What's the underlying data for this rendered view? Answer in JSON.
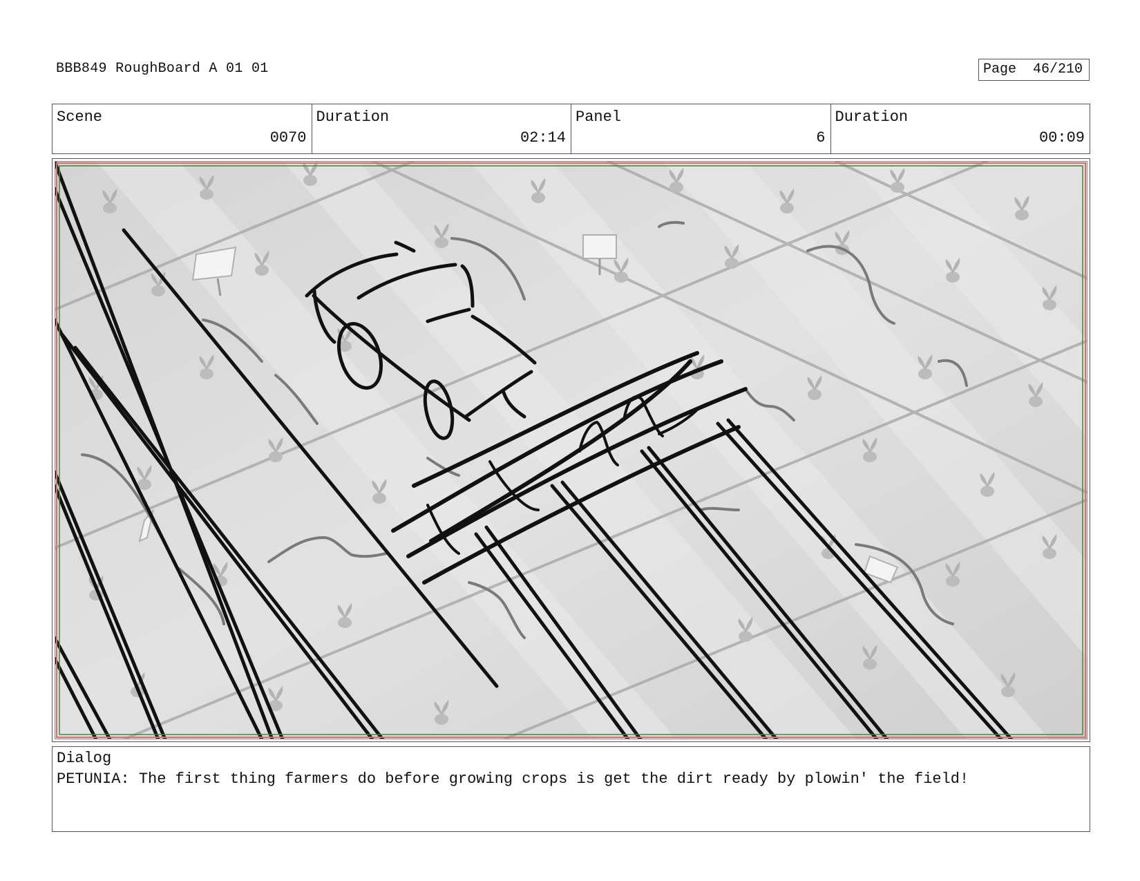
{
  "header": {
    "title": "BBB849 RoughBoard A 01 01",
    "page_label": "Page",
    "page_number": "46/210"
  },
  "meta": {
    "scene_label": "Scene",
    "scene_value": "0070",
    "scene_duration_label": "Duration",
    "scene_duration_value": "02:14",
    "panel_label": "Panel",
    "panel_value": "6",
    "panel_duration_label": "Duration",
    "panel_duration_value": "00:09"
  },
  "dialog": {
    "label": "Dialog",
    "text": "PETUNIA: The first thing farmers do before growing crops is get the dirt ready by plowin' the field!"
  },
  "colors": {
    "safe_frame_outer": "#e06b6b",
    "safe_frame_inner": "#3a8a3a",
    "background_gray": "#d9d9d9"
  }
}
